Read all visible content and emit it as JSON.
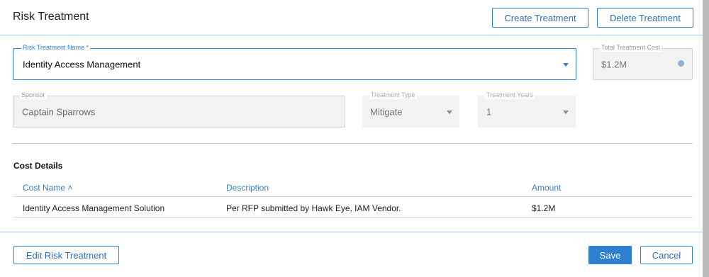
{
  "header": {
    "title": "Risk Treatment",
    "create_label": "Create Treatment",
    "delete_label": "Delete Treatment"
  },
  "form": {
    "treatment_name": {
      "label": "Risk Treatment Name *",
      "value": "Identity Access Management"
    },
    "total_cost": {
      "label": "Total Treatment Cost",
      "value": "$1.2M",
      "icon": "info-icon"
    },
    "sponsor": {
      "label": "Sponsor",
      "value": "Captain Sparrows"
    },
    "treatment_type": {
      "label": "Treatment Type",
      "value": "Mitigate"
    },
    "treatment_years": {
      "label": "Treatment Years",
      "value": "1"
    }
  },
  "cost_details": {
    "title": "Cost Details",
    "columns": [
      "Cost Name ˄",
      "Description",
      "Amount"
    ],
    "rows": [
      [
        "Identity Access Management Solution",
        "Per RFP submitted by Hawk Eye, IAM Vendor.",
        "$1.2M"
      ]
    ]
  },
  "footer": {
    "edit_label": "Edit Risk Treatment",
    "save_label": "Save",
    "cancel_label": "Cancel"
  },
  "colors": {
    "accent": "#2f7fd0",
    "header_text": "#3a7fc4",
    "disabled_bg": "#f2f2f2"
  }
}
